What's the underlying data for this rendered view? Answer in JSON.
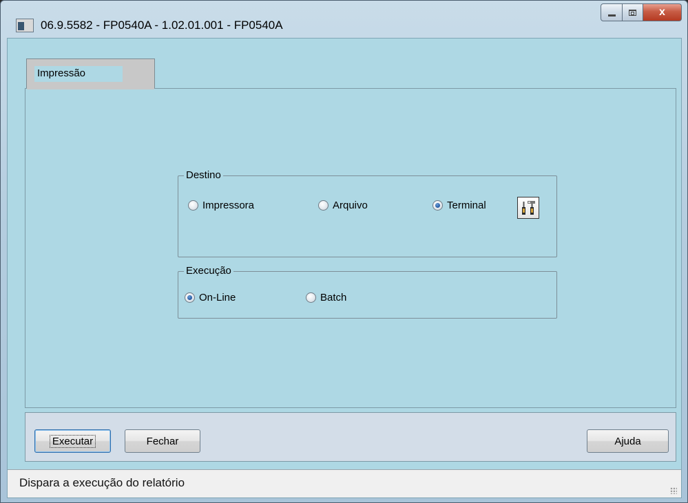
{
  "window": {
    "title": "06.9.5582 - FP0540A - 1.02.01.001 - FP0540A",
    "controls": {
      "minimize": "",
      "maximize": "",
      "close": "x"
    }
  },
  "tabs": [
    {
      "label": "Impressão",
      "active": true
    }
  ],
  "destino": {
    "label": "Destino",
    "options": [
      {
        "label": "Impressora",
        "checked": false
      },
      {
        "label": "Arquivo",
        "checked": false
      },
      {
        "label": "Terminal",
        "checked": true
      }
    ],
    "config_icon": "tools-icon"
  },
  "execucao": {
    "label": "Execução",
    "options": [
      {
        "label": "On-Line",
        "checked": true
      },
      {
        "label": "Batch",
        "checked": false
      }
    ]
  },
  "buttons": {
    "executar": "Executar",
    "fechar": "Fechar",
    "ajuda": "Ajuda"
  },
  "status": {
    "text": "Dispara a execução do relatório"
  }
}
